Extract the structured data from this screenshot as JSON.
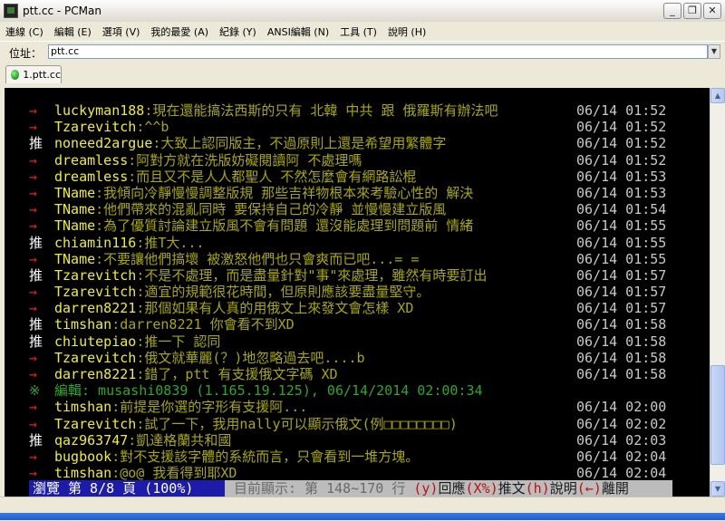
{
  "window": {
    "title": "ptt.cc - PCMan",
    "buttons": {
      "minimize": "_",
      "restore": "❐",
      "close": "✕"
    }
  },
  "menu": [
    "連線 (C)",
    "編輯 (E)",
    "選項 (V)",
    "我的最愛 (A)",
    "紀錄 (Y)",
    "ANSI編輯 (N)",
    "工具 (T)",
    "說明 (H)"
  ],
  "address": {
    "label": "位址：",
    "value": "ptt.cc",
    "dropdown": "▼"
  },
  "tabs": [
    {
      "label": "1.ptt.cc"
    }
  ],
  "terminal": {
    "lines": [
      {
        "mark": "→",
        "kind": "arrow",
        "user": "luckyman188",
        "msg": ":現在還能搞法西斯的只有 北韓 中共 跟 俄羅斯有辦法吧",
        "time": "06/14 01:52"
      },
      {
        "mark": "→",
        "kind": "arrow",
        "user": "Tzarevitch",
        "msg": ":^^b",
        "time": "06/14 01:52"
      },
      {
        "mark": "推",
        "kind": "push",
        "user": "noneed2argue",
        "msg": ":大致上認同版主，不過原則上還是希望用繁體字",
        "time": "06/14 01:52"
      },
      {
        "mark": "→",
        "kind": "arrow",
        "user": "dreamless",
        "msg": ":阿對方就在洗版妨礙閱讀阿 不處理嗎",
        "time": "06/14 01:52"
      },
      {
        "mark": "→",
        "kind": "arrow",
        "user": "dreamless",
        "msg": ":而且又不是人人都聖人 不然怎麼會有網路訟棍",
        "time": "06/14 01:53"
      },
      {
        "mark": "→",
        "kind": "arrow",
        "user": "TName",
        "msg": ":我傾向冷靜慢慢調整版規  那些吉祥物根本來考驗心性的  解決",
        "time": "06/14 01:53"
      },
      {
        "mark": "→",
        "kind": "arrow",
        "user": "TName",
        "msg": ":他們帶來的混亂同時  要保持自己的冷靜  並慢慢建立版風",
        "time": "06/14 01:54"
      },
      {
        "mark": "→",
        "kind": "arrow",
        "user": "TName",
        "msg": ":為了優質討論建立版風不會有問題  還沒能處理到問題前  情緒",
        "time": "06/14 01:55"
      },
      {
        "mark": "推",
        "kind": "push",
        "user": "chiamin116",
        "msg": ":推T大...",
        "time": "06/14 01:55"
      },
      {
        "mark": "→",
        "kind": "arrow",
        "user": "TName",
        "msg": ":不要讓他們搞壞  被激怒他們也只會爽而已吧...= =",
        "time": "06/14 01:55"
      },
      {
        "mark": "推",
        "kind": "push",
        "user": "Tzarevitch",
        "msg": ":不是不處理，而是盡量針對\"事\"來處理，雖然有時要訂出",
        "time": "06/14 01:57"
      },
      {
        "mark": "→",
        "kind": "arrow",
        "user": "Tzarevitch",
        "msg": ":適宜的規範很花時間，但原則應該要盡量堅守。",
        "time": "06/14 01:57"
      },
      {
        "mark": "→",
        "kind": "arrow",
        "user": "darren8221",
        "msg": ":那個如果有人真的用俄文上來發文會怎樣 XD",
        "time": "06/14 01:57"
      },
      {
        "mark": "推",
        "kind": "push",
        "user": "timshan",
        "msg": ":darren8221 你會看不到XD",
        "time": "06/14 01:58"
      },
      {
        "mark": "推",
        "kind": "push",
        "user": "chiutepiao",
        "msg": ":推一下 認同",
        "time": "06/14 01:58"
      },
      {
        "mark": "→",
        "kind": "arrow",
        "user": "Tzarevitch",
        "msg": ":俄文就華麗(？)地忽略過去吧....b",
        "time": "06/14 01:58"
      },
      {
        "mark": "→",
        "kind": "arrow",
        "user": "darren8221",
        "msg": ":錯了，ptt 有支援俄文字碼 XD",
        "time": "06/14 01:58"
      },
      {
        "mark": "※",
        "kind": "edit",
        "user": "",
        "msg": "編輯: musashi0839 (1.165.19.125), 06/14/2014 02:00:34",
        "time": ""
      },
      {
        "mark": "→",
        "kind": "arrow",
        "user": "timshan",
        "msg": ":前提是你選的字形有支援阿...",
        "time": "06/14 02:00"
      },
      {
        "mark": "→",
        "kind": "arrow",
        "user": "Tzarevitch",
        "msg": ":試了一下，我用nally可以顯示俄文(例□□□□□□□□)",
        "time": "06/14 02:02"
      },
      {
        "mark": "推",
        "kind": "push",
        "user": "qaz963747",
        "msg": ":凱達格蘭共和國",
        "time": "06/14 02:03"
      },
      {
        "mark": "→",
        "kind": "arrow",
        "user": "bugbook",
        "msg": ":對不支援該字體的系統而言，只會看到一堆方塊。",
        "time": "06/14 02:04"
      },
      {
        "mark": "→",
        "kind": "arrow",
        "user": "timshan",
        "msg": ":@o@ 我看得到耶XD",
        "time": "06/14 02:04"
      }
    ],
    "status": {
      "browse": "瀏覽 第 8/8 頁 (100%)",
      "range": "目前顯示: 第 148~170 行",
      "k1": "(y)",
      "t1": "回應",
      "k2": "(X%)",
      "t2": "推文",
      "k3": "(h)",
      "t3": "說明",
      "k4": "(←)",
      "t4": "離開"
    }
  },
  "colors": {
    "arrow": "#e52020",
    "push": "#ffffff",
    "user": "#f0f020",
    "message": "#a8a800",
    "time": "#c8c8c8",
    "edit": "#2aa82a",
    "status_browse_bg": "#1c1ca8",
    "status_rest_bg": "#bcbcbc"
  }
}
